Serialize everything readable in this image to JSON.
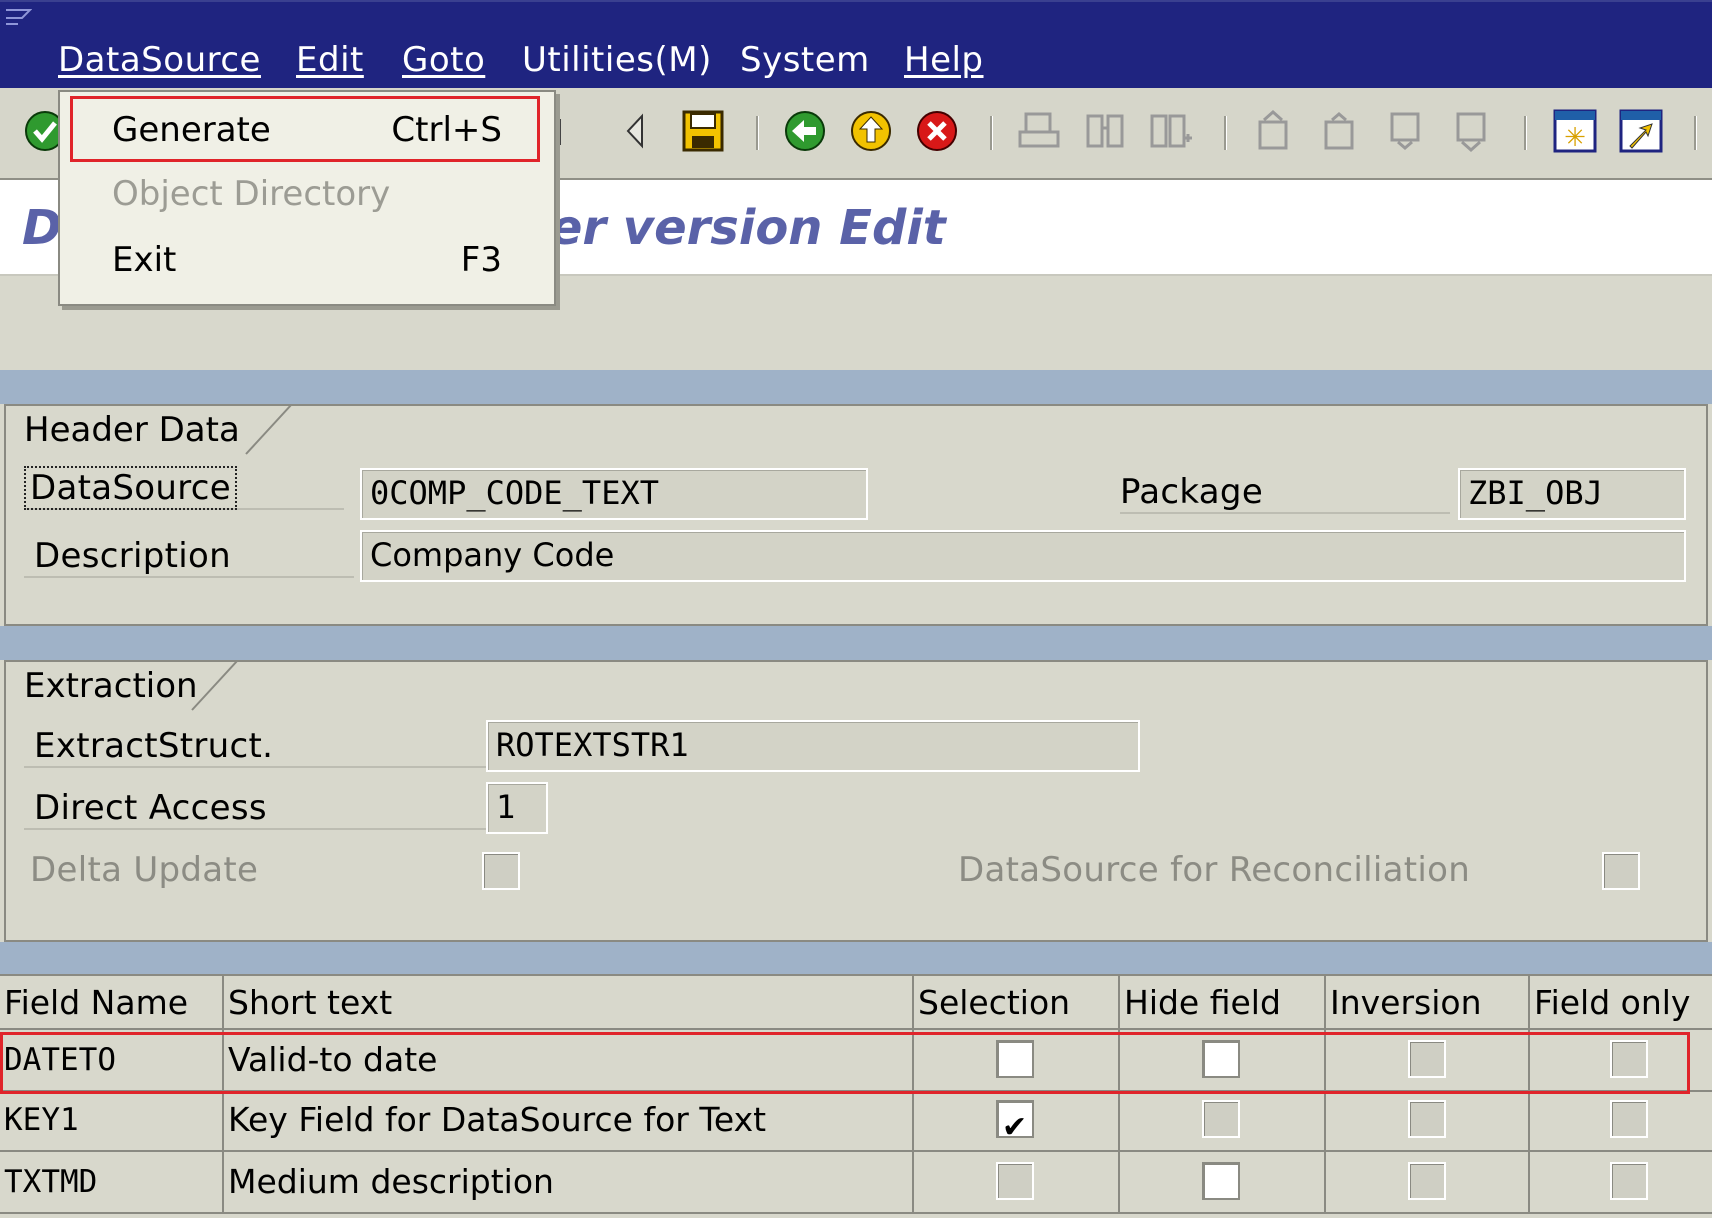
{
  "menubar": {
    "items": [
      {
        "label": "DataSource"
      },
      {
        "label": "Edit"
      },
      {
        "label": "Goto"
      },
      {
        "label": "Utilities(M)"
      },
      {
        "label": "System"
      },
      {
        "label": "Help"
      }
    ]
  },
  "dropdown": {
    "items": [
      {
        "label": "Generate",
        "shortcut": "Ctrl+S",
        "enabled": true
      },
      {
        "label": "Object Directory",
        "shortcut": "",
        "enabled": false
      },
      {
        "label": "Exit",
        "shortcut": "F3",
        "enabled": true
      }
    ]
  },
  "title": {
    "left": "D",
    "right": "er version Edit"
  },
  "header_data": {
    "tab": "Header Data",
    "datasource_label": "DataSource",
    "datasource_value": "0COMP_CODE_TEXT",
    "package_label": "Package",
    "package_value": "ZBI_OBJ",
    "description_label": "Description",
    "description_value": "Company Code"
  },
  "extraction": {
    "tab": "Extraction",
    "extractstruct_label": "ExtractStruct.",
    "extractstruct_value": "ROTEXTSTR1",
    "direct_access_label": "Direct Access",
    "direct_access_value": "1",
    "delta_update_label": "Delta Update",
    "reconciliation_label": "DataSource for Reconciliation"
  },
  "table": {
    "columns": [
      "Field Name",
      "Short text",
      "Selection",
      "Hide field",
      "Inversion",
      "Field only"
    ],
    "rows": [
      {
        "field": "DATETO",
        "text": "Valid-to date",
        "selection": false,
        "hide": false,
        "inversion": false,
        "field_only": false
      },
      {
        "field": "KEY1",
        "text": "Key Field for DataSource for Text",
        "selection": true,
        "hide": false,
        "inversion": false,
        "field_only": false
      },
      {
        "field": "TXTMD",
        "text": "Medium description",
        "selection": false,
        "hide": false,
        "inversion": false,
        "field_only": false
      }
    ]
  },
  "colors": {
    "menubar": "#1f2480",
    "title": "#5a62a8",
    "highlight": "#e0242a"
  }
}
